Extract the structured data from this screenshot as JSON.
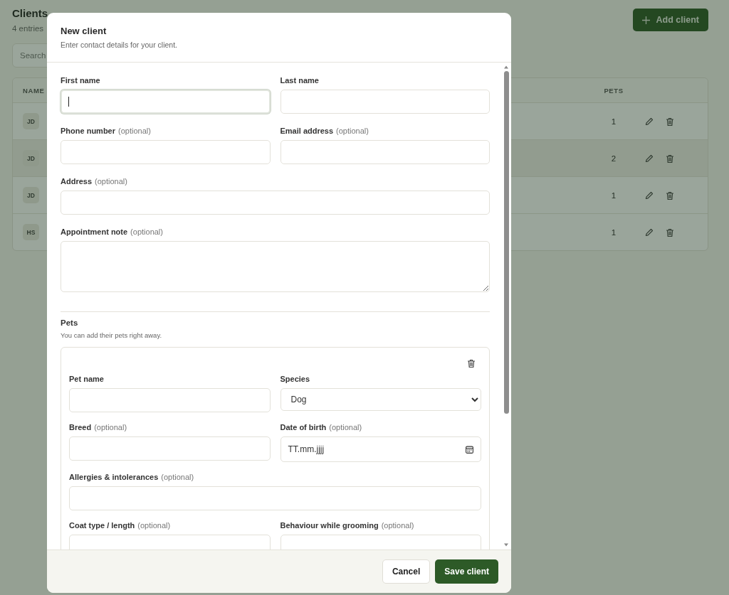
{
  "page": {
    "title": "Clients",
    "count": "4 entries",
    "add_button": "Add client",
    "search": {
      "placeholder": "Search"
    },
    "table": {
      "columns": [
        "NAME",
        "PETS"
      ],
      "rows": [
        {
          "initials": "JD",
          "pets": "1",
          "hovered": false
        },
        {
          "initials": "JD",
          "pets": "2",
          "hovered": true
        },
        {
          "initials": "JD",
          "pets": "1",
          "hovered": false
        },
        {
          "initials": "HS",
          "pets": "1",
          "hovered": false
        }
      ]
    }
  },
  "dialog": {
    "title": "New client",
    "subtitle": "Enter contact details for your client.",
    "rows": [
      [
        {
          "kind": "text",
          "label": "First name",
          "focused": true
        },
        {
          "kind": "text",
          "label": "Last name",
          "focused": false
        }
      ],
      [
        {
          "kind": "text",
          "label": "Phone number",
          "hint": "(optional)",
          "focused": false
        },
        {
          "kind": "text",
          "label": "Email address",
          "hint": "(optional)",
          "focused": false
        }
      ],
      [
        {
          "kind": "text",
          "label": "Address",
          "hint": "(optional)",
          "focused": false
        }
      ],
      [
        {
          "kind": "textarea",
          "label": "Appointment note",
          "hint": "(optional)",
          "focused": false
        }
      ]
    ],
    "pets_section": {
      "title": "Pets",
      "subtitle": "You can add their pets right away.",
      "pets": [
        {
          "rows": [
            [
              {
                "kind": "text",
                "label": "Pet name",
                "focused": false
              },
              {
                "kind": "select",
                "label": "Species",
                "value": "Dog",
                "focused": false
              }
            ],
            [
              {
                "kind": "text",
                "label": "Breed",
                "hint": "(optional)",
                "focused": false
              },
              {
                "kind": "date",
                "label": "Date of birth",
                "hint": "(optional)",
                "placeholder": "TT.mm.jjjj",
                "focused": false
              }
            ],
            [
              {
                "kind": "text",
                "label": "Allergies & intolerances",
                "hint": "(optional)",
                "focused": false
              }
            ],
            [
              {
                "kind": "text",
                "label": "Coat type / length",
                "hint": "(optional)",
                "focused": false
              },
              {
                "kind": "text",
                "label": "Behaviour while grooming",
                "hint": "(optional)",
                "focused": false
              }
            ]
          ]
        }
      ]
    },
    "buttons": [
      {
        "label": "Cancel",
        "kind": "secondary"
      },
      {
        "label": "Save client",
        "kind": "primary"
      }
    ]
  }
}
